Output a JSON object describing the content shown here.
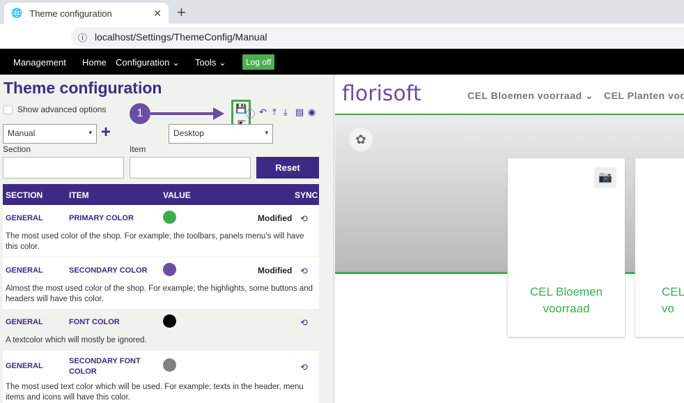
{
  "browser": {
    "tab_title": "Theme configuration",
    "url": "localhost/Settings/ThemeConfig/Manual"
  },
  "nav": {
    "brand": "Management",
    "items": [
      "Home",
      "Configuration",
      "Tools"
    ],
    "logoff": "Log off"
  },
  "page": {
    "title": "Theme configuration",
    "show_advanced": "Show advanced options",
    "mode_select": "Manual",
    "device_select": "Desktop",
    "section_label": "Section",
    "item_label": "Item",
    "reset": "Reset",
    "annotation": "1"
  },
  "table": {
    "headers": [
      "SECTION",
      "ITEM",
      "VALUE",
      "SYNC"
    ],
    "rows": [
      {
        "section": "GENERAL",
        "item": "PRIMARY COLOR",
        "color": "#3cad4f",
        "status": "Modified",
        "desc": "The most used color of the shop. For example; the toolbars, panels menu's will have this color."
      },
      {
        "section": "GENERAL",
        "item": "SECONDARY COLOR",
        "color": "#6a4ea3",
        "status": "Modified",
        "desc": "Almost the most used color of the shop. For example; the highlights, some buttons and headers will have this color."
      },
      {
        "section": "GENERAL",
        "item": "FONT COLOR",
        "color": "#000000",
        "status": "",
        "desc": "A textcolor which will mostly be ignored."
      },
      {
        "section": "GENERAL",
        "item": "SECONDARY FONT COLOR",
        "color": "#808080",
        "status": "",
        "desc": "The most used text color which will be used. For example; texts in the header, menu items and icons will have this color."
      }
    ]
  },
  "preview": {
    "logo": "florisoft",
    "menu": [
      "CEL Bloemen voorraad",
      "CEL Planten voo"
    ],
    "card": "CEL Bloemen voorraad",
    "card2": "CEL vo"
  }
}
